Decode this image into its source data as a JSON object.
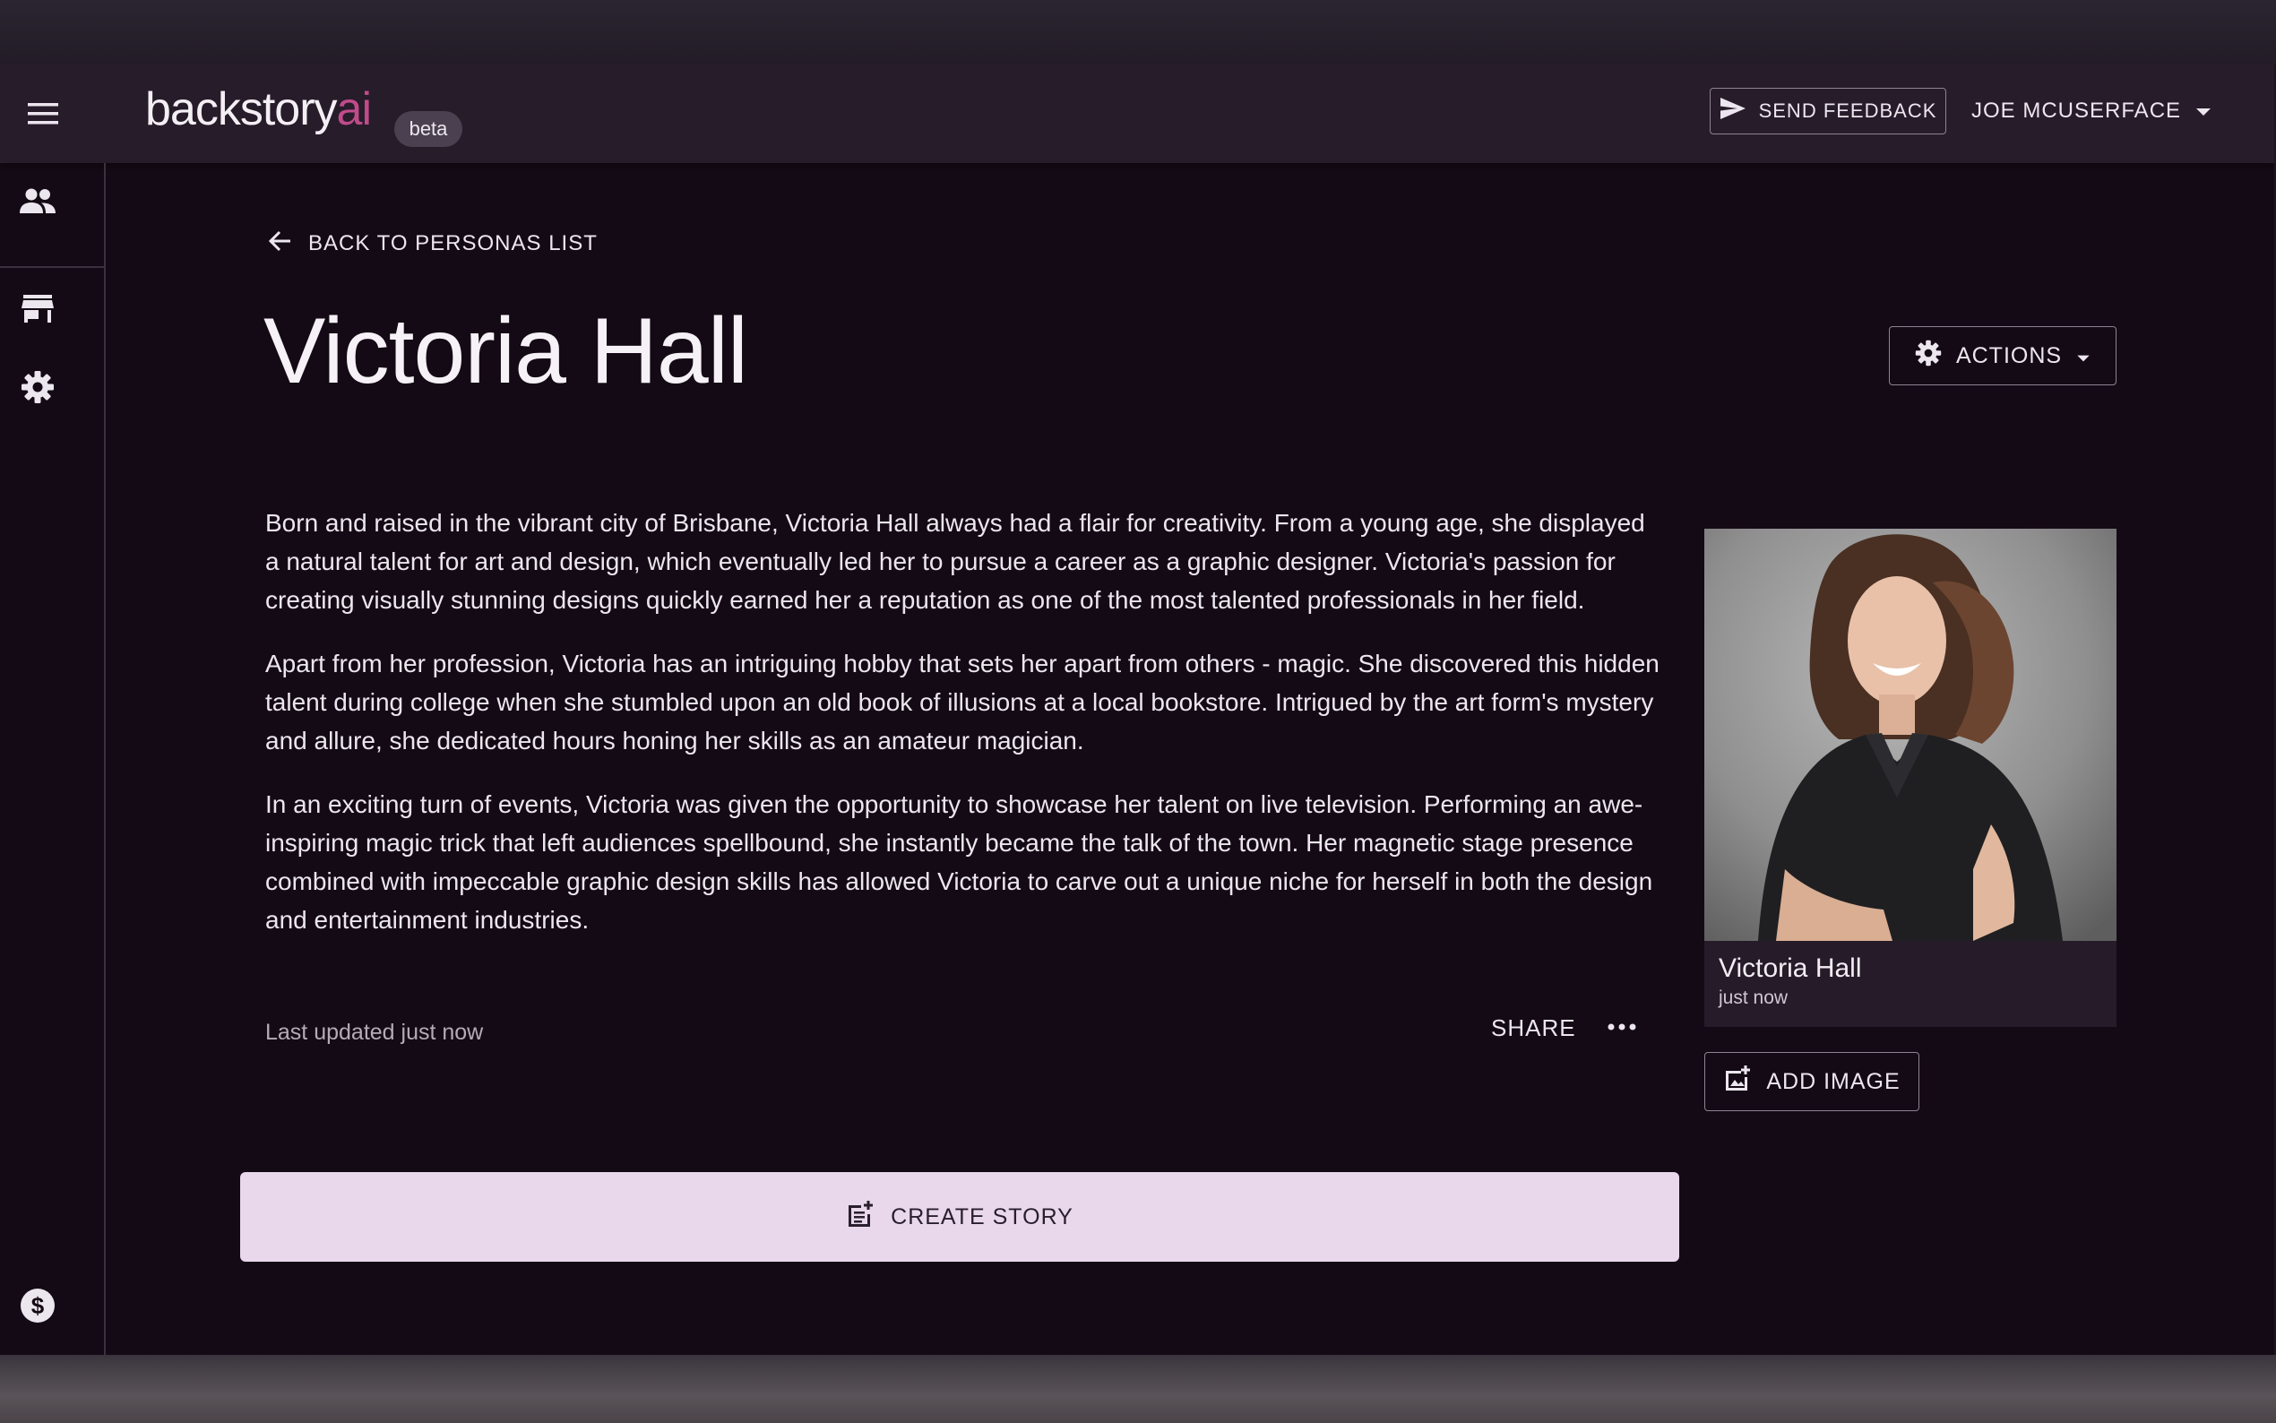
{
  "app": {
    "logo_main": "backstory",
    "logo_accent": "ai",
    "beta_badge": "beta",
    "feedback_label": "SEND FEEDBACK",
    "user_name": "JOE MCUSERFACE"
  },
  "sidebar": {
    "items": [
      {
        "icon": "people-icon"
      },
      {
        "icon": "store-icon"
      },
      {
        "icon": "gear-icon"
      },
      {
        "icon": "dollar-circle-icon"
      }
    ]
  },
  "main": {
    "back_label": "BACK TO PERSONAS LIST",
    "persona_name": "Victoria Hall",
    "actions_label": "ACTIONS",
    "bio": [
      "Born and raised in the vibrant city of Brisbane, Victoria Hall always had a flair for creativity. From a young age, she displayed a natural talent for art and design, which eventually led her to pursue a career as a graphic designer. Victoria's passion for creating visually stunning designs quickly earned her a reputation as one of the most talented professionals in her field.",
      "Apart from her profession, Victoria has an intriguing hobby that sets her apart from others - magic. She discovered this hidden talent during college when she stumbled upon an old book of illusions at a local bookstore. Intrigued by the art form's mystery and allure, she dedicated hours honing her skills as an amateur magician.",
      "In an exciting turn of events, Victoria was given the opportunity to showcase her talent on live television. Performing an awe-inspiring magic trick that left audiences spellbound, she instantly became the talk of the town. Her magnetic stage presence combined with impeccable graphic design skills has allowed Victoria to carve out a unique niche for herself in both the design and entertainment industries."
    ],
    "last_updated": "Last updated just now",
    "share_label": "SHARE",
    "create_story_label": "CREATE STORY"
  },
  "image_card": {
    "name": "Victoria Hall",
    "time": "just now",
    "add_image_label": "ADD IMAGE"
  },
  "colors": {
    "background": "#140a15",
    "appbar": "#271c2a",
    "accent": "#c04b8b",
    "create_story_bg": "#e9d8ec"
  }
}
